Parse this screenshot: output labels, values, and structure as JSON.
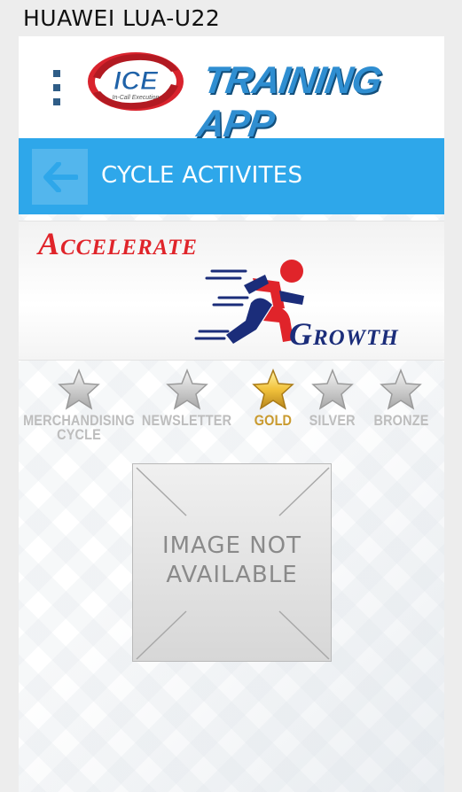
{
  "device": {
    "label": "HUAWEI LUA-U22"
  },
  "header": {
    "logo_badge_text": "ICE",
    "logo_badge_subtext": "In-Call Execution",
    "logo_title": "TRAINING APP"
  },
  "title_bar": {
    "title": "CYCLE ACTIVITES"
  },
  "banner": {
    "word_1": "Accelerate",
    "word_2": "Growth"
  },
  "levels": [
    {
      "label": "MERCHANDISING\nCYCLE",
      "icon": "star-icon",
      "active": false
    },
    {
      "label": "NEWSLETTER",
      "icon": "star-icon",
      "active": false
    },
    {
      "label": "GOLD",
      "icon": "star-icon",
      "active": true
    },
    {
      "label": "SILVER",
      "icon": "star-icon",
      "active": false
    },
    {
      "label": "BRONZE",
      "icon": "star-icon",
      "active": false
    }
  ],
  "content": {
    "placeholder_text": "IMAGE NOT\nAVAILABLE"
  },
  "colors": {
    "title_bar": "#2ea7ea",
    "gold": "#c99a2e",
    "inactive": "#bdbdbd",
    "banner_red": "#e0242a",
    "banner_navy": "#1b2d7a"
  }
}
